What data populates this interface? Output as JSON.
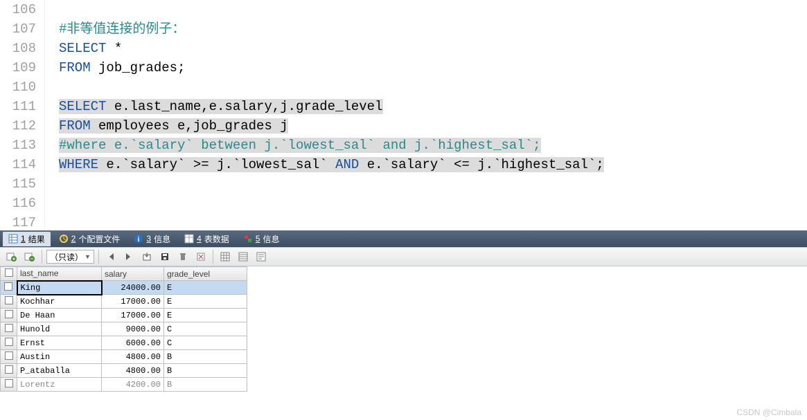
{
  "editor": {
    "line_numbers": [
      "106",
      "107",
      "108",
      "109",
      "110",
      "111",
      "112",
      "113",
      "114",
      "115",
      "116",
      "117"
    ],
    "lines": {
      "l107": {
        "t0": "#非等值连接的例子："
      },
      "l108": {
        "k0": "SELECT",
        "t0": " *"
      },
      "l109": {
        "k0": "FROM",
        "t0": " job_grades;"
      },
      "l111": {
        "k0": "SELECT",
        "t0": " e.last_name,e.salary,j.grade_level"
      },
      "l112": {
        "k0": "FROM",
        "t0": " employees e,job_grades j"
      },
      "l113": {
        "t0": "#where e.`salary` between j.`lowest_sal` and j.`highest_sal`;"
      },
      "l114": {
        "k0": "WHERE",
        "t0": " e.`salary` >= j.`lowest_sal` ",
        "k1": "AND",
        "t1": " e.`salary` <= j.`highest_sal`;"
      }
    }
  },
  "tabs": {
    "t1": {
      "idx": "1",
      "label": "结果"
    },
    "t2": {
      "idx": "2",
      "label": "个配置文件"
    },
    "t3": {
      "idx": "3",
      "label": "信息"
    },
    "t4": {
      "idx": "4",
      "label": "表数据"
    },
    "t5": {
      "idx": "5",
      "label": "信息"
    }
  },
  "toolbar": {
    "readonly_label": "（只读）"
  },
  "grid": {
    "headers": {
      "c0": "last_name",
      "c1": "salary",
      "c2": "grade_level"
    },
    "rows": [
      {
        "last_name": "King",
        "salary": "24000.00",
        "grade_level": "E",
        "selected": true
      },
      {
        "last_name": "Kochhar",
        "salary": "17000.00",
        "grade_level": "E"
      },
      {
        "last_name": "De Haan",
        "salary": "17000.00",
        "grade_level": "E"
      },
      {
        "last_name": "Hunold",
        "salary": "9000.00",
        "grade_level": "C"
      },
      {
        "last_name": "Ernst",
        "salary": "6000.00",
        "grade_level": "C"
      },
      {
        "last_name": "Austin",
        "salary": "4800.00",
        "grade_level": "B"
      },
      {
        "last_name": "P_ataballa",
        "salary": "4800.00",
        "grade_level": "B"
      },
      {
        "last_name": "Lorentz",
        "salary": "4200.00",
        "grade_level": "B",
        "partial": true
      }
    ]
  },
  "watermark": "CSDN @Cimbala"
}
